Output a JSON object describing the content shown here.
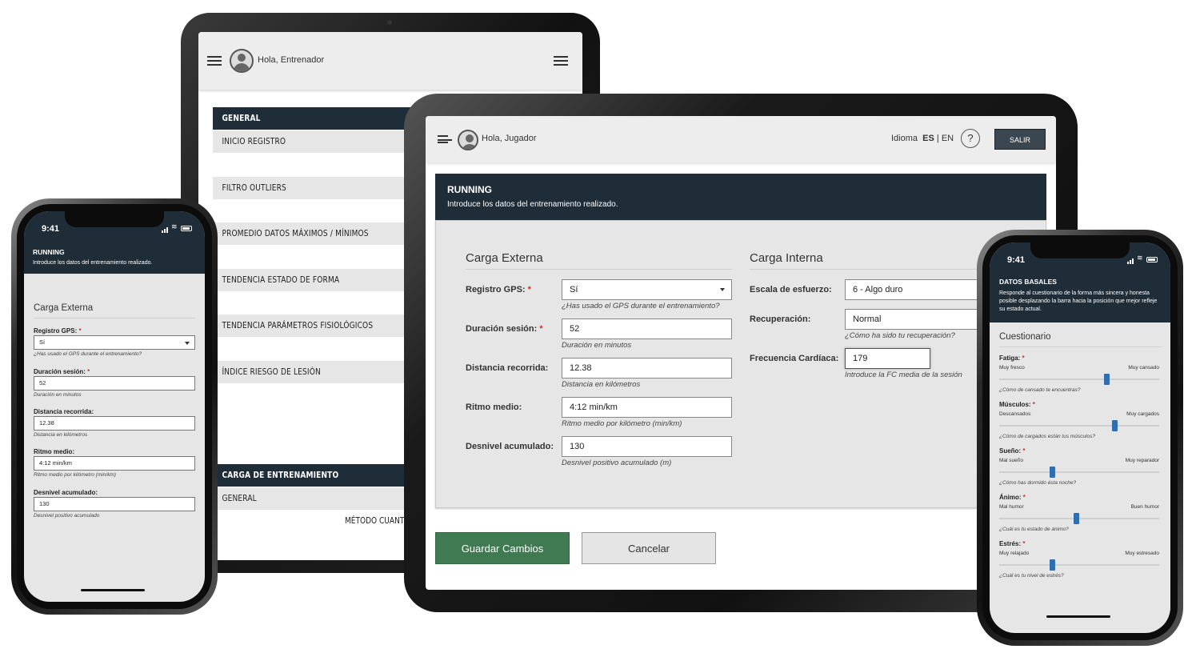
{
  "coach": {
    "greeting": "Hola, Entrenador",
    "nav": [
      {
        "label": "GENERAL",
        "style": "dark"
      },
      {
        "label": "INICIO REGISTRO",
        "style": "light"
      },
      {
        "label": "FILTRO OUTLIERS",
        "style": "light"
      },
      {
        "label": "PROMEDIO DATOS MÁXIMOS / MÍNIMOS",
        "style": "light"
      },
      {
        "label": "TENDENCIA ESTADO DE FORMA",
        "style": "light"
      },
      {
        "label": "TENDENCIA PARÁMETROS FISIOLÓGICOS",
        "style": "light"
      },
      {
        "label": "ÍNDICE RIESGO DE LESIÓN",
        "style": "light"
      },
      {
        "label": "CARGA DE ENTRENAMIENTO",
        "style": "dark"
      },
      {
        "label": "GENERAL",
        "style": "light"
      }
    ],
    "partial_row": "MÉTODO CUANTIF"
  },
  "player": {
    "greeting": "Hola, Jugador",
    "lang_label": "Idioma",
    "lang_es": "ES",
    "lang_sep": "|",
    "lang_en": "EN",
    "help": "?",
    "logout": "SALIR",
    "card_title": "RUNNING",
    "card_subtitle": "Introduce los datos del entrenamiento realizado.",
    "external": {
      "title": "Carga Externa",
      "fields": [
        {
          "label": "Registro GPS:",
          "required": true,
          "value": "Sí",
          "hint": "¿Has usado el GPS durante el entrenamiento?",
          "select": true
        },
        {
          "label": "Duración sesión:",
          "required": true,
          "value": "52",
          "hint": "Duración en minutos"
        },
        {
          "label": "Distancia recorrida:",
          "required": false,
          "value": "12.38",
          "hint": "Distancia en kilómetros"
        },
        {
          "label": "Ritmo medio:",
          "required": false,
          "value": "4:12 min/km",
          "hint": "Ritmo medio por kilómetro (min/km)"
        },
        {
          "label": "Desnivel acumulado:",
          "required": false,
          "value": "130",
          "hint": "Desnivel positivo acumulado (m)"
        }
      ]
    },
    "internal": {
      "title": "Carga Interna",
      "fields": [
        {
          "label": "Escala de esfuerzo:",
          "value": "6 - Algo duro",
          "hint": ""
        },
        {
          "label": "Recuperación:",
          "value": "Normal",
          "hint": "¿Cómo ha sido tu recuperación?"
        },
        {
          "label": "Frecuencia Cardíaca:",
          "value": "179",
          "hint": "Introduce la FC media de la sesión"
        }
      ]
    },
    "save": "Guardar Cambios",
    "cancel": "Cancelar"
  },
  "phone_left": {
    "time": "9:41",
    "title": "RUNNING",
    "subtitle": "Introduce los datos del entrenamiento realizado.",
    "section": "Carga Externa",
    "fields": [
      {
        "label": "Registro GPS:",
        "required": true,
        "value": "Sí",
        "hint": "¿Has usado el GPS durante el entrenamiento?",
        "select": true
      },
      {
        "label": "Duración sesión:",
        "required": true,
        "value": "52",
        "hint": "Duración en minutos"
      },
      {
        "label": "Distancia recorrida:",
        "required": false,
        "value": "12.38",
        "hint": "Distancia en kilómetros"
      },
      {
        "label": "Ritmo medio:",
        "required": false,
        "value": "4:12 min/km",
        "hint": "Ritmo medio por kilómetro (min/km)"
      },
      {
        "label": "Desnivel acumulado:",
        "required": false,
        "value": "130",
        "hint": "Desnivel positivo acumulado"
      }
    ]
  },
  "phone_right": {
    "time": "9:41",
    "title": "DATOS BASALES",
    "subtitle": "Responde al cuestionario de la forma más sincera y honesta posible desplazando la barra hacia la posición que mejor refleje su estado actual.",
    "section": "Cuestionario",
    "sliders": [
      {
        "label": "Fatiga:",
        "min": "Muy fresco",
        "max": "Muy cansado",
        "hint": "¿Cómo de cansado te encuentras?",
        "level": 0.67
      },
      {
        "label": "Músculos:",
        "min": "Descansados",
        "max": "Muy cargados",
        "hint": "¿Cómo de cargados están tus músculos?",
        "level": 0.72
      },
      {
        "label": "Sueño:",
        "min": "Mal sueño",
        "max": "Muy reparador",
        "hint": "¿Cómo has dormido ésta noche?",
        "level": 0.33
      },
      {
        "label": "Ánimo:",
        "min": "Mal humor",
        "max": "Buen humor",
        "hint": "¿Cuál es tu estado de ánimo?",
        "level": 0.48
      },
      {
        "label": "Estrés:",
        "min": "Muy relajado",
        "max": "Muy estresado",
        "hint": "¿Cuál es tu nivel de estrés?",
        "level": 0.33
      }
    ]
  },
  "colors": {
    "navy": "#1f2d38",
    "save_green": "#3f7a52",
    "slider_blue": "#2f6fb0",
    "required_red": "#c0392b"
  }
}
